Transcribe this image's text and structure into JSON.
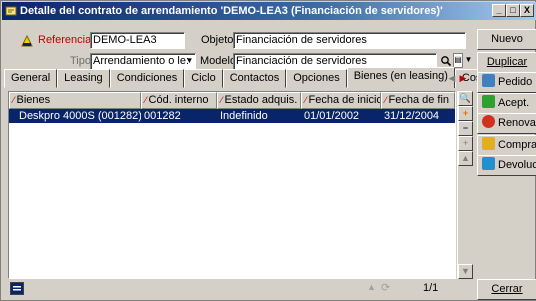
{
  "window": {
    "title": "Detalle del contrato de arrendamiento 'DEMO-LEA3 (Financiación de servidores)'",
    "controls": {
      "minimize": "_",
      "maximize": "□",
      "close": "X"
    }
  },
  "header": {
    "referencia_label": "Referencia:",
    "referencia_value": "DEMO-LEA3",
    "objeto_label": "Objeto:",
    "objeto_value": "Financiación de servidores",
    "tipo_label": "Tipo:",
    "tipo_value": "Arrendamiento o le:",
    "modelo_label": "Modelo:",
    "modelo_value": "Financiación de servidores"
  },
  "tabs": [
    {
      "label": "General"
    },
    {
      "label": "Leasing"
    },
    {
      "label": "Condiciones"
    },
    {
      "label": "Ciclo"
    },
    {
      "label": "Contactos"
    },
    {
      "label": "Opciones"
    },
    {
      "label": "Bienes (en leasing)"
    },
    {
      "label": "Cost"
    }
  ],
  "active_tab": "Bienes (en leasing)",
  "grid": {
    "columns": [
      "Bienes",
      "Cód. interno",
      "Estado adquis.",
      "Fecha de inicio",
      "Fecha de fin"
    ],
    "rows": [
      [
        "Deskpro 4000S (001282)",
        "001282",
        "Indefinido",
        "01/01/2002",
        "31/12/2004"
      ]
    ]
  },
  "status": {
    "pager": "1/1"
  },
  "side_buttons": {
    "nuevo": "Nuevo",
    "duplicar": "Duplicar",
    "pedido": "Pedido",
    "acept": "Acept.",
    "renovac": "Renovac",
    "compra": "Compra",
    "devoluc": "Devoluc",
    "cerrar": "Cerrar"
  },
  "colors": {
    "title_gradient_start": "#0a246a",
    "selection": "#0a246a",
    "required_label": "#c00000",
    "window_face": "#d4d0c8"
  }
}
